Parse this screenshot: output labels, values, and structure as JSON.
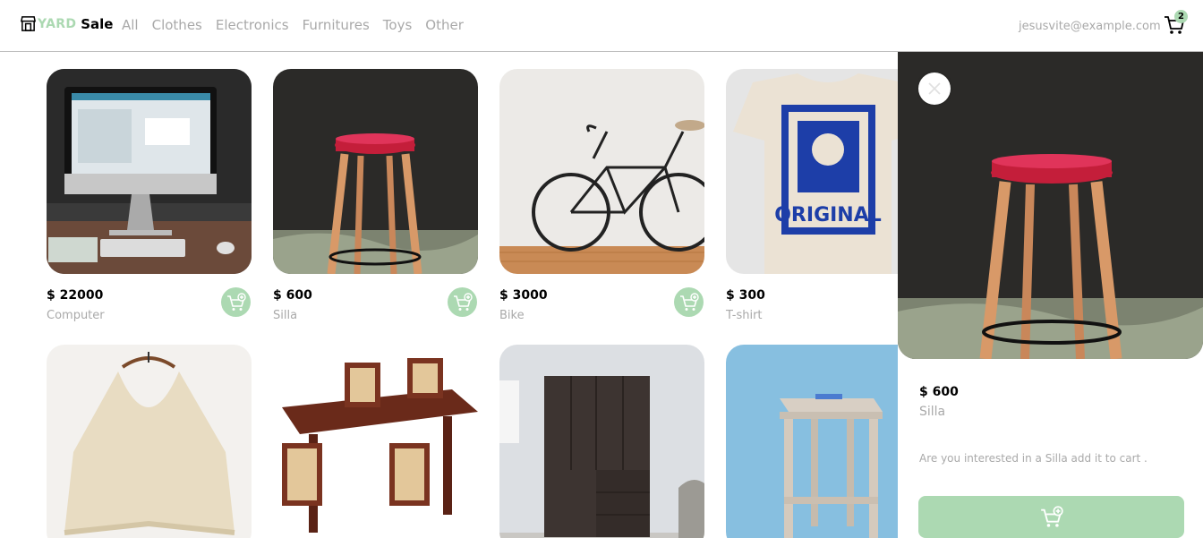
{
  "navbar": {
    "logo_yard": "YARD",
    "logo_sale": "Sale",
    "logo_icon": "store-icon",
    "links": [
      "All",
      "Clothes",
      "Electronics",
      "Furnitures",
      "Toys",
      "Other"
    ],
    "email": "jesusvite@example.com",
    "cart_count": "2",
    "cart_icon": "cart-icon"
  },
  "products": [
    {
      "price": "$ 22000",
      "name": "Computer",
      "image": "computer-image"
    },
    {
      "price": "$ 600",
      "name": "Silla",
      "image": "stool-image"
    },
    {
      "price": "$ 3000",
      "name": "Bike",
      "image": "bike-image"
    },
    {
      "price": "$ 300",
      "name": "T-shirt",
      "image": "tshirt-image"
    },
    {
      "image": "poncho-image"
    },
    {
      "image": "dining-table-image"
    },
    {
      "image": "wardrobe-image"
    },
    {
      "image": "wooden-stool-image"
    }
  ],
  "detail": {
    "price": "$ 600",
    "name": "Silla",
    "description": "Are you interested in a Silla add it to cart .",
    "image": "stool-image",
    "close_icon": "close-icon",
    "add_icon": "cart-add-icon"
  },
  "colors": {
    "accent": "#acd9b2",
    "muted_text": "#a9a9a9",
    "border": "#bdbdbd"
  }
}
